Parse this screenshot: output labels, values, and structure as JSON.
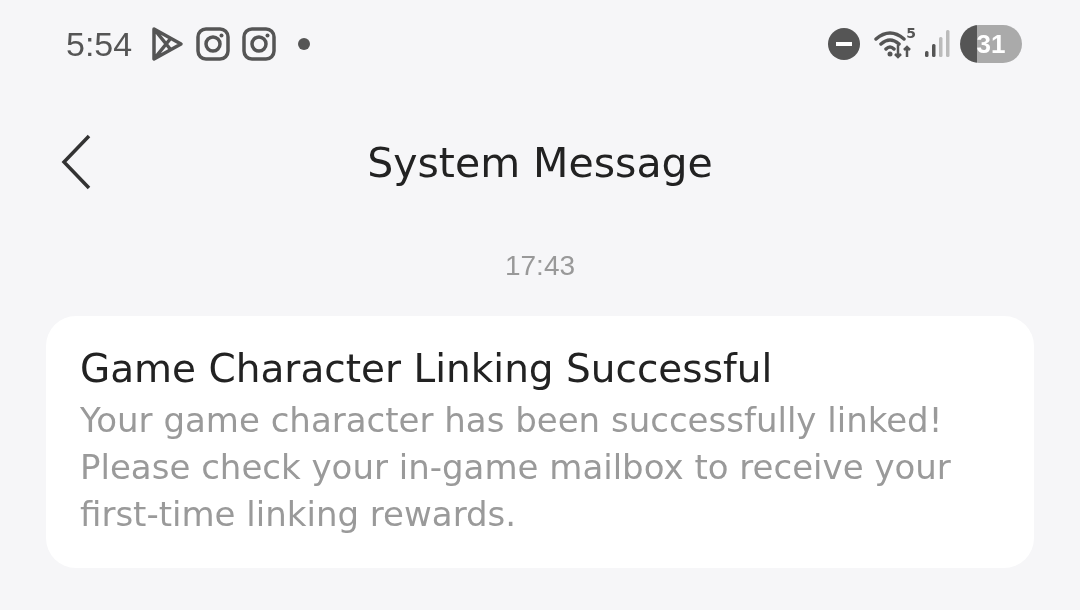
{
  "status_bar": {
    "time": "5:54",
    "wifi_badge": "5",
    "battery": "31"
  },
  "header": {
    "title": "System Message"
  },
  "timestamp": "17:43",
  "message": {
    "title": "Game Character Linking Successful",
    "body": "Your game character has been successfully linked! Please check your in-game mailbox to receive your first-time linking rewards."
  }
}
